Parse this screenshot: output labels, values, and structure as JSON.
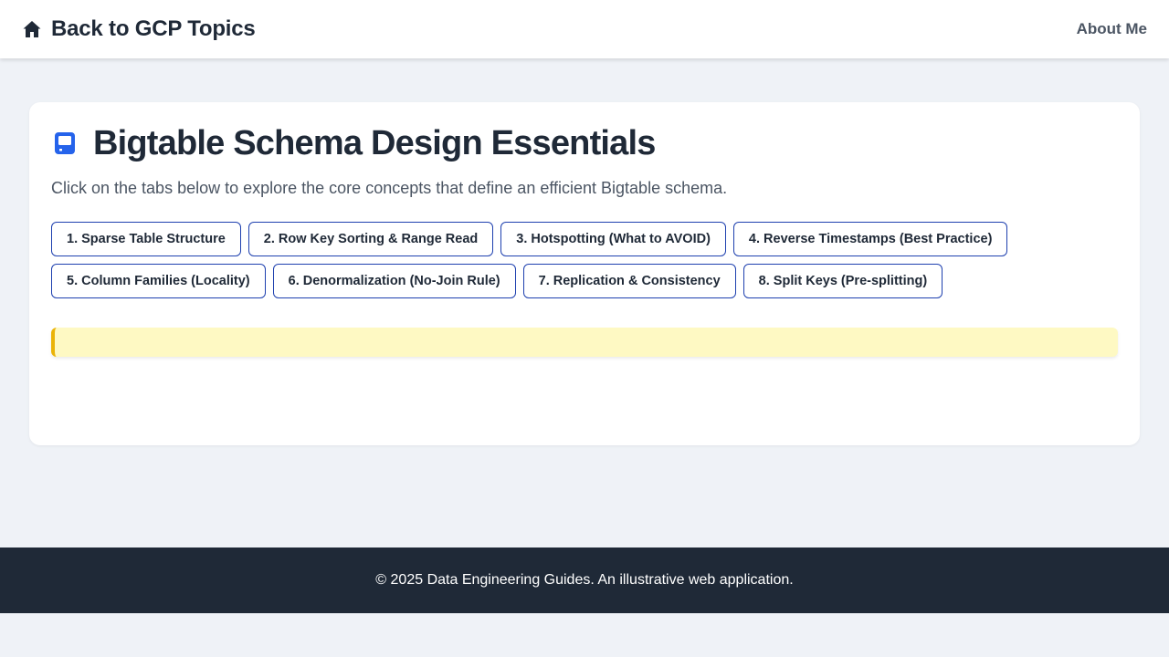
{
  "header": {
    "back_label": "Back to GCP Topics",
    "back_icon": "home-icon",
    "about_label": "About Me"
  },
  "main": {
    "title": "Bigtable Schema Design Essentials",
    "title_icon": "tablet-device-icon",
    "accent_color": "#2563eb",
    "subtitle": "Click on the tabs below to explore the core concepts that define an efficient Bigtable schema.",
    "tabs": [
      {
        "label": "1. Sparse Table Structure"
      },
      {
        "label": "2. Row Key Sorting & Range Read"
      },
      {
        "label": "3. Hotspotting (What to AVOID)"
      },
      {
        "label": "4. Reverse Timestamps (Best Practice)"
      },
      {
        "label": "5. Column Families (Locality)"
      },
      {
        "label": "6. Denormalization (No-Join Rule)"
      },
      {
        "label": "7. Replication & Consistency"
      },
      {
        "label": "8. Split Keys (Pre-splitting)"
      }
    ],
    "info_box": {
      "text": "",
      "background_color": "#fef9c3",
      "border_color": "#eab308"
    }
  },
  "footer": {
    "text": "© 2025 Data Engineering Guides. An illustrative web application."
  }
}
